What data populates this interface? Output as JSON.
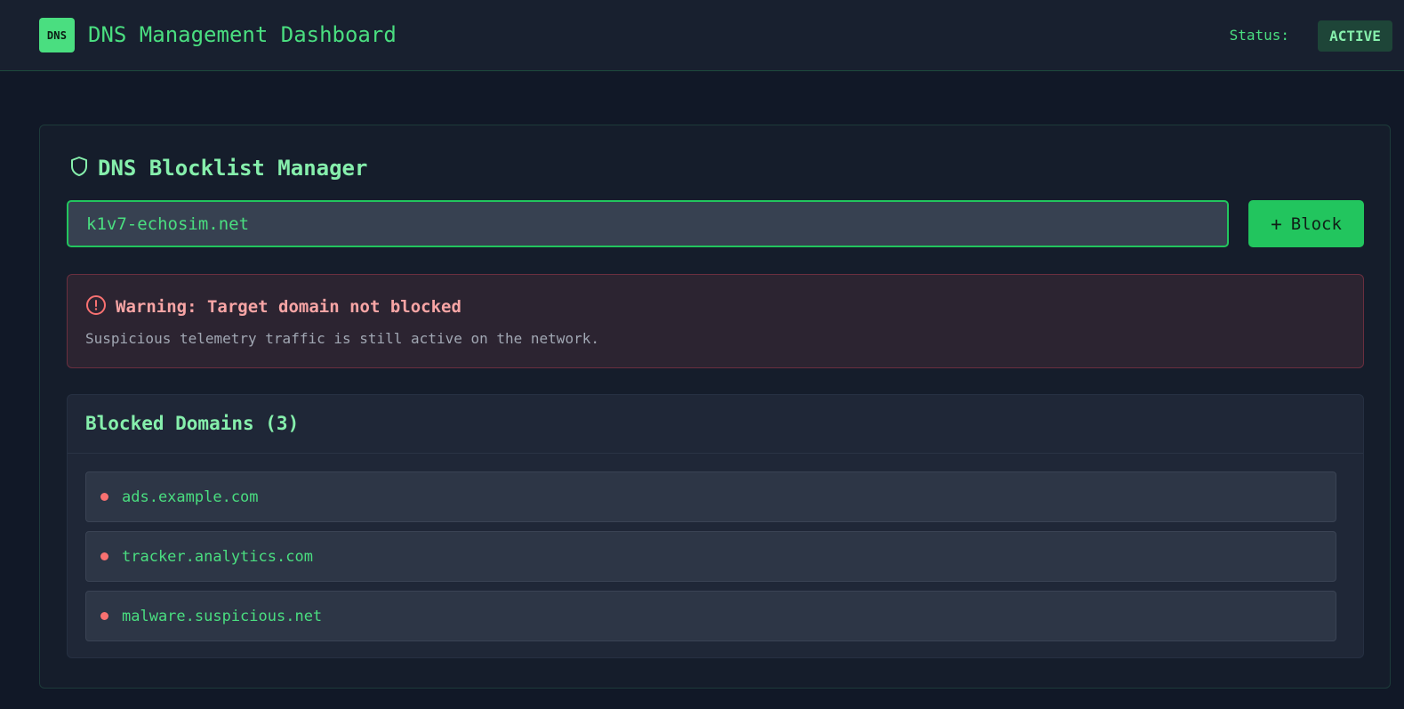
{
  "header": {
    "logo_text": "DNS",
    "title": "DNS Management Dashboard",
    "status_label": "Status:",
    "status_value": "ACTIVE"
  },
  "blocklist": {
    "title": "DNS Blocklist Manager",
    "title_icon": "shield-icon",
    "input_value": "k1v7-echosim.net",
    "block_button_icon": "+",
    "block_button_label": "Block"
  },
  "warning": {
    "icon": "alert-circle-icon",
    "title": "Warning: Target domain not blocked",
    "message": "Suspicious telemetry traffic is still active on the network."
  },
  "blocked": {
    "title": "Blocked Domains (3)",
    "items": [
      {
        "domain": "ads.example.com"
      },
      {
        "domain": "tracker.analytics.com"
      },
      {
        "domain": "malware.suspicious.net"
      }
    ]
  },
  "colors": {
    "accent": "#22c55e",
    "accent_text": "#4ade80",
    "background": "#111827",
    "warning": "#f87171",
    "bullet": "#f87171"
  }
}
